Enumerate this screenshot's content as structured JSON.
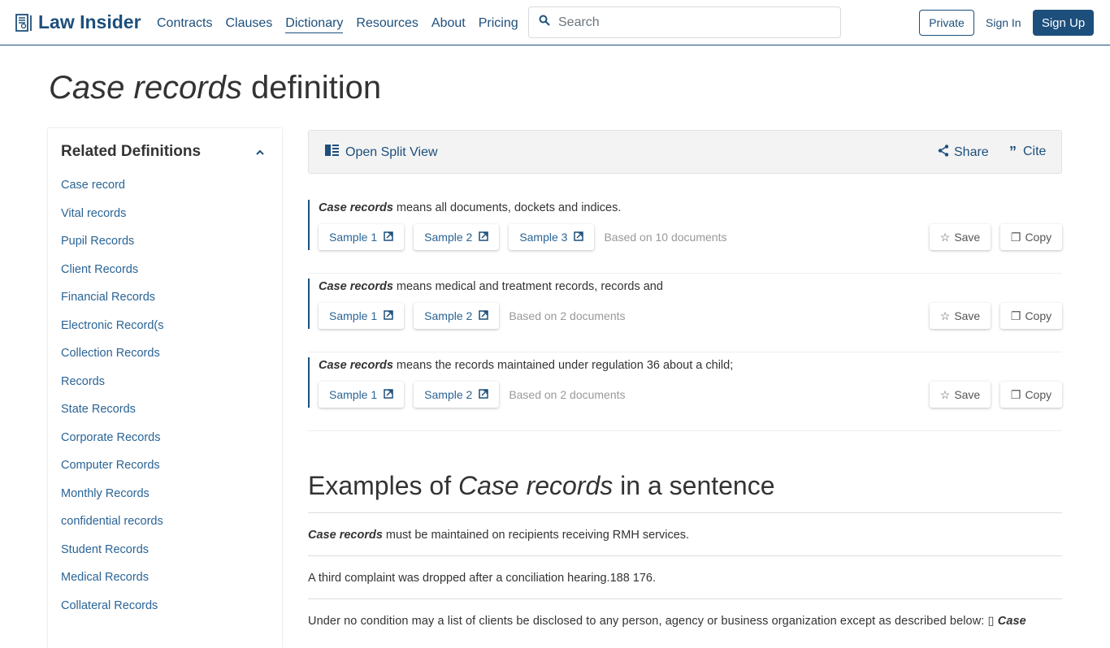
{
  "header": {
    "logo_text": "Law Insider",
    "nav": [
      "Contracts",
      "Clauses",
      "Dictionary",
      "Resources",
      "About",
      "Pricing"
    ],
    "active_nav": "Dictionary",
    "search_placeholder": "Search",
    "private_label": "Private",
    "signin_label": "Sign In",
    "signup_label": "Sign Up"
  },
  "page": {
    "title_term": "Case records",
    "title_suffix": " definition"
  },
  "sidebar": {
    "title": "Related Definitions",
    "items": [
      "Case record",
      "Vital records",
      "Pupil Records",
      "Client Records",
      "Financial Records",
      "Electronic Record(s",
      "Collection Records",
      "Records",
      "State Records",
      "Corporate Records",
      "Computer Records",
      "Monthly Records",
      "confidential records",
      "Student Records",
      "Medical Records",
      "Collateral Records"
    ]
  },
  "toolbar": {
    "split_view": "Open Split View",
    "share": "Share",
    "cite": "Cite"
  },
  "definitions": [
    {
      "term": "Case records",
      "text": " means all documents, dockets and indices.",
      "samples": [
        "Sample 1",
        "Sample 2",
        "Sample 3"
      ],
      "based_on": "Based on 10 documents"
    },
    {
      "term": "Case records",
      "text": " means medical and treatment records, records and",
      "samples": [
        "Sample 1",
        "Sample 2"
      ],
      "based_on": "Based on 2 documents"
    },
    {
      "term": "Case records",
      "text": " means the records maintained under regulation 36 about a child;",
      "samples": [
        "Sample 1",
        "Sample 2"
      ],
      "based_on": "Based on 2 documents"
    }
  ],
  "actions": {
    "save": "Save",
    "copy": "Copy"
  },
  "examples": {
    "title_prefix": "Examples of ",
    "title_term": "Case records",
    "title_suffix": " in a sentence",
    "sentences": [
      {
        "term": "Case records",
        "text": " must be maintained on recipients receiving RMH services."
      },
      {
        "term": "",
        "text": "A third complaint was dropped after a conciliation hearing.188 176."
      },
      {
        "term": "Case",
        "text": "Under no condition may a list of clients be disclosed to any person, agency or business organization except as described below: ▯ ",
        "term_after": true
      }
    ]
  }
}
